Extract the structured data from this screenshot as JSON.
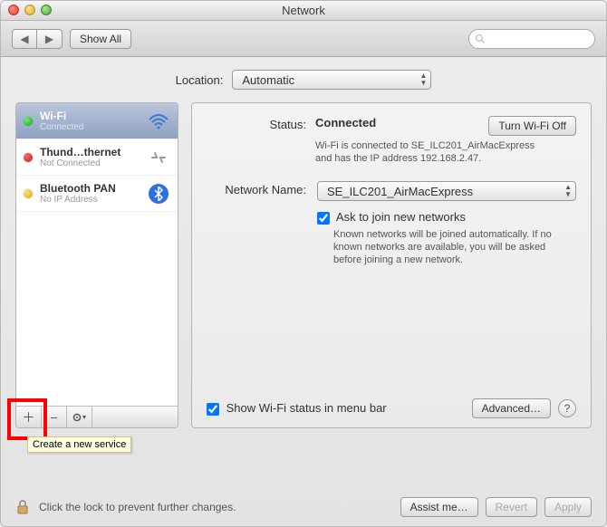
{
  "window": {
    "title": "Network"
  },
  "toolbar": {
    "showall": "Show All"
  },
  "location": {
    "label": "Location:",
    "value": "Automatic"
  },
  "sidebar": {
    "items": [
      {
        "name": "Wi-Fi",
        "sub": "Connected",
        "status": "green",
        "icon": "wifi"
      },
      {
        "name": "Thund…thernet",
        "sub": "Not Connected",
        "status": "red",
        "icon": "thunderbolt"
      },
      {
        "name": "Bluetooth PAN",
        "sub": "No IP Address",
        "status": "yellow",
        "icon": "bluetooth"
      }
    ],
    "add_tooltip": "Create a new service"
  },
  "main": {
    "status_label": "Status:",
    "status_value": "Connected",
    "turn_off": "Turn Wi-Fi Off",
    "status_detail": "Wi-Fi is connected to SE_ILC201_AirMacExpress and has the IP address 192.168.2.47.",
    "network_name_label": "Network Name:",
    "network_name_value": "SE_ILC201_AirMacExpress",
    "ask_join_label": "Ask to join new networks",
    "ask_join_detail": "Known networks will be joined automatically. If no known networks are available, you will be asked before joining a new network.",
    "show_status_label": "Show Wi-Fi status in menu bar",
    "advanced": "Advanced…"
  },
  "bottom": {
    "lock_text": "Click the lock to prevent further changes.",
    "assist": "Assist me…",
    "revert": "Revert",
    "apply": "Apply"
  }
}
